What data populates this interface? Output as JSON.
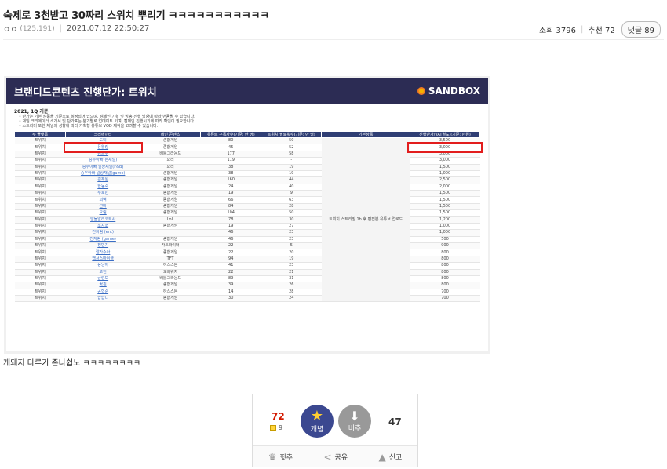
{
  "post": {
    "title": "숙제로 3천받고 30짜리 스위치 뿌리기 ㅋㅋㅋㅋㅋㅋㅋㅋㅋㅋㅋ",
    "author": "ㅇㅇ",
    "ip": "(125.191)",
    "datetime": "2021.07.12 22:50:27",
    "views_label": "조회 3796",
    "recommend_label": "추천 72",
    "comments_label": "댓글 89",
    "caption": "개돼지 다루기 존나쉽노 ㅋㅋㅋㅋㅋㅋㅋㅋ"
  },
  "embed": {
    "banner_title": "브랜디드콘텐츠 진행단가: 트위치",
    "logo_text": "SANDBOX",
    "year_label": "2021, 1Q 기준",
    "notes": [
      "• 단가는 기본 상품을 기준으로 설정되어 있으며, 캠페인 기획 및 방송 진행 방향에 따라 변동될 수 있습니다.",
      "• 게임 크리에이터 소개서 및 단가표는 분기별로 업데이트 되며, 캠페인 진행시기에 따라 확인이 필요합니다.",
      "• 스트리머 또한 채널의 성향에 따라 기획형 유튜브 VOD 제작을 고려할 수 있습니다."
    ],
    "headers": [
      "주 플랫폼",
      "크리에이터",
      "메인 콘텐츠",
      "유튜브 구독자수(기준: 만 명)",
      "트위치 팔로워수(기준: 만 명)",
      "기본상품",
      "진행단가/VAT별도 (기준: 만원)"
    ],
    "base_product": "트위치 스트리밍 1h 후 편집본 유튜브 업로드",
    "rows": [
      {
        "platform": "트위치",
        "creator": "도티",
        "content": "종합게임",
        "yt": "80",
        "tw": "50",
        "price": "3,500"
      },
      {
        "platform": "트위치",
        "creator": "풍월량",
        "content": "종합게임",
        "yt": "45",
        "tw": "52",
        "price": "3,000"
      },
      {
        "platform": "트위치",
        "creator": "김블루",
        "content": "배틀그라운드",
        "yt": "177",
        "tw": "58",
        "price": "3,000"
      },
      {
        "platform": "트위치",
        "creator": "승우아빠(본채널)",
        "content": "요리",
        "yt": "119",
        "tw": "-",
        "price": "3,000"
      },
      {
        "platform": "트위치",
        "creator": "승우아빠 일상채널(F&B)",
        "content": "요리",
        "yt": "38",
        "tw": "19",
        "price": "1,500"
      },
      {
        "platform": "트위치",
        "creator": "승우아빠 일상채널(game)",
        "content": "종합게임",
        "yt": "38",
        "tw": "19",
        "price": "1,000"
      },
      {
        "platform": "트위치",
        "creator": "김재원",
        "content": "종합게임",
        "yt": "160",
        "tw": "44",
        "price": "2,500"
      },
      {
        "platform": "트위치",
        "creator": "한동숙",
        "content": "종합게임",
        "yt": "24",
        "tw": "40",
        "price": "2,000"
      },
      {
        "platform": "트위치",
        "creator": "주호민",
        "content": "종합게임",
        "yt": "19",
        "tw": "9",
        "price": "1,500"
      },
      {
        "platform": "트위치",
        "creator": "괴벽",
        "content": "종합게임",
        "yt": "66",
        "tw": "63",
        "price": "1,500"
      },
      {
        "platform": "트위치",
        "creator": "선바",
        "content": "종합게임",
        "yt": "84",
        "tw": "28",
        "price": "1,500"
      },
      {
        "platform": "트위치",
        "creator": "요림",
        "content": "종합게임",
        "yt": "104",
        "tw": "50",
        "price": "1,500"
      },
      {
        "platform": "트위치",
        "creator": "앙돌알리코트사",
        "content": "LoL",
        "yt": "78",
        "tw": "30",
        "price": "1,200"
      },
      {
        "platform": "트위치",
        "creator": "소시소",
        "content": "종합게임",
        "yt": "19",
        "tw": "27",
        "price": "1,000"
      },
      {
        "platform": "트위치",
        "creator": "진자림 (ent)",
        "content": "",
        "yt": "46",
        "tw": "23",
        "price": "1,000"
      },
      {
        "platform": "트위치",
        "creator": "진자림 (game)",
        "content": "종합게임",
        "yt": "46",
        "tw": "23",
        "price": "500"
      },
      {
        "platform": "트위치",
        "creator": "정민기",
        "content": "카트라이더",
        "yt": "22",
        "tw": "5",
        "price": "900"
      },
      {
        "platform": "트위치",
        "creator": "랄라수아",
        "content": "종합게임",
        "yt": "22",
        "tw": "20",
        "price": "800"
      },
      {
        "platform": "트위치",
        "creator": "백서스마이클",
        "content": "TFT",
        "yt": "94",
        "tw": "19",
        "price": "800"
      },
      {
        "platform": "트위치",
        "creator": "동냥아",
        "content": "하스스톤",
        "yt": "41",
        "tw": "23",
        "price": "800"
      },
      {
        "platform": "트위치",
        "creator": "또현",
        "content": "오버워치",
        "yt": "22",
        "tw": "21",
        "price": "800"
      },
      {
        "platform": "트위치",
        "creator": "군림보",
        "content": "배틀그라운드",
        "yt": "89",
        "tw": "31",
        "price": "800"
      },
      {
        "platform": "트위치",
        "creator": "꽃핀",
        "content": "종합게임",
        "yt": "39",
        "tw": "26",
        "price": "800"
      },
      {
        "platform": "트위치",
        "creator": "공혁준",
        "content": "하스스톤",
        "yt": "14",
        "tw": "28",
        "price": "700"
      },
      {
        "platform": "트위치",
        "creator": "얍얍디",
        "content": "종합게임",
        "yt": "30",
        "tw": "24",
        "price": "700"
      }
    ]
  },
  "vote": {
    "up_count": "72",
    "fix_count": "9",
    "up_label": "개념",
    "down_label": "비추",
    "down_count": "47",
    "actions": {
      "hit": "힛추",
      "share": "공유",
      "report": "신고"
    }
  }
}
